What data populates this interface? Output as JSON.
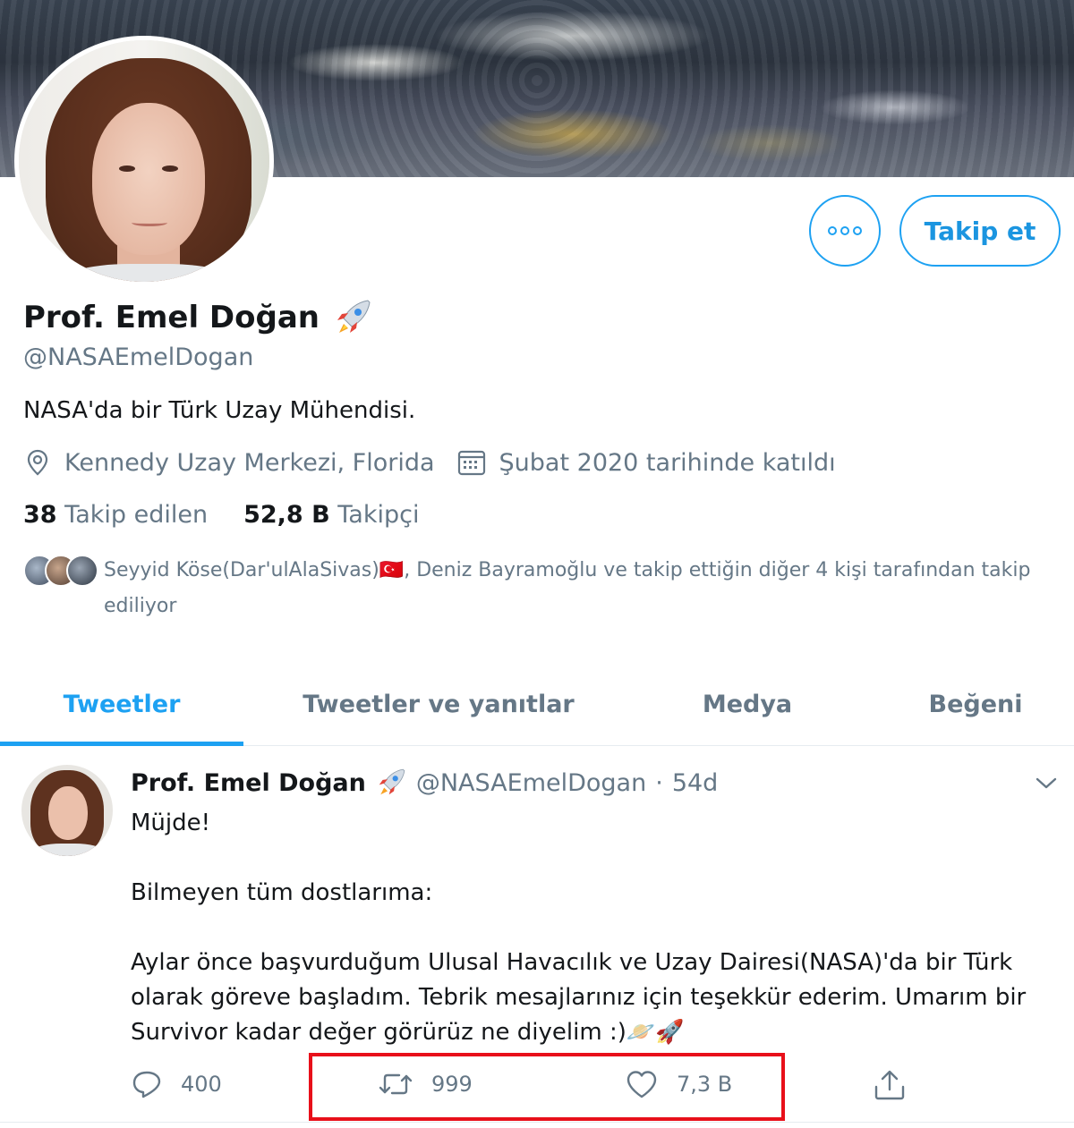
{
  "profile": {
    "name": "Prof. Emel Doğan",
    "name_emoji": "rocket-icon",
    "handle": "@NASAEmelDogan",
    "bio": "NASA'da bir Türk Uzay Mühendisi.",
    "location": "Kennedy Uzay Merkezi, Florida",
    "joined": "Şubat 2020 tarihinde katıldı",
    "following_count": "38",
    "following_label": "Takip edilen",
    "followers_count": "52,8 B",
    "followers_label": "Takipçi",
    "followed_by": "Seyyid Köse(Dar'ulAlaSivas)🇹🇷, Deniz Bayramoğlu ve takip ettiğin diğer 4 kişi tarafından takip ediliyor"
  },
  "buttons": {
    "more_icon": "more-icon",
    "follow_label": "Takip et"
  },
  "tabs": [
    {
      "label": "Tweetler",
      "active": true
    },
    {
      "label": "Tweetler ve yanıtlar",
      "active": false
    },
    {
      "label": "Medya",
      "active": false
    },
    {
      "label": "Beğeni",
      "active": false
    }
  ],
  "tweet": {
    "name": "Prof. Emel Doğan",
    "handle": "@NASAEmelDogan",
    "separator": "·",
    "time": "54d",
    "lines": {
      "l1": "Müjde!",
      "l2": "Bilmeyen tüm dostlarıma:",
      "l3": "Aylar önce başvurduğum Ulusal Havacılık ve Uzay Dairesi(NASA)'da bir Türk olarak göreve başladım. Tebrik mesajlarınız için teşekkür ederim. Umarım bir Survivor kadar değer görürüz ne diyelim :)🪐🚀"
    },
    "replies": "400",
    "retweets": "999",
    "likes": "7,3 B"
  },
  "colors": {
    "accent": "#1da1f2",
    "muted": "#657786",
    "highlight": "#e8101a"
  }
}
